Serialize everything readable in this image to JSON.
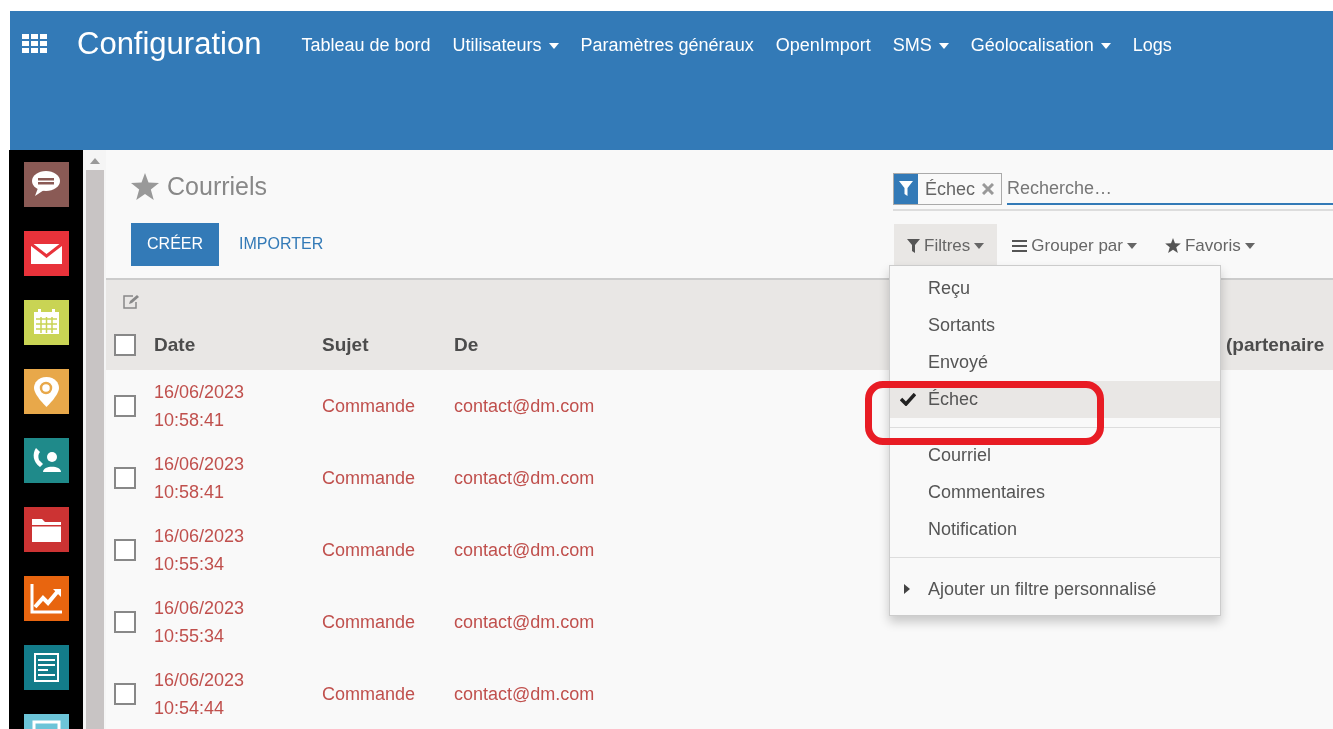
{
  "navbar": {
    "app_title": "Configuration",
    "menu": [
      {
        "label": "Tableau de bord",
        "dropdown": false
      },
      {
        "label": "Utilisateurs",
        "dropdown": true
      },
      {
        "label": "Paramètres généraux",
        "dropdown": false
      },
      {
        "label": "OpenImport",
        "dropdown": false
      },
      {
        "label": "SMS",
        "dropdown": true
      },
      {
        "label": "Géolocalisation",
        "dropdown": true
      },
      {
        "label": "Logs",
        "dropdown": false
      }
    ]
  },
  "sidebar": {
    "apps": [
      {
        "kind": "chat",
        "color": "#8a5a55"
      },
      {
        "kind": "mail",
        "color": "#e8323a"
      },
      {
        "kind": "calendar",
        "color": "#c9d454"
      },
      {
        "kind": "pin",
        "color": "#e8a84a"
      },
      {
        "kind": "phone",
        "color": "#1f8a8a"
      },
      {
        "kind": "folder",
        "color": "#cc3333"
      },
      {
        "kind": "chart",
        "color": "#e8650f"
      },
      {
        "kind": "document",
        "color": "#137c8a"
      },
      {
        "kind": "window",
        "color": "#6cc4d8"
      }
    ]
  },
  "breadcrumb": {
    "title": "Courriels"
  },
  "buttons": [
    {
      "label": "CRÉER",
      "kind": "primary"
    },
    {
      "label": "IMPORTER",
      "kind": "link"
    }
  ],
  "search": {
    "facet": "Échec",
    "placeholder": "Recherche…"
  },
  "search_options": [
    {
      "label": "Filtres",
      "kind": "filter",
      "selected": true
    },
    {
      "label": "Grouper par",
      "kind": "group",
      "selected": false
    },
    {
      "label": "Favoris",
      "kind": "star",
      "selected": false
    }
  ],
  "filter_menu": {
    "groups": [
      [
        {
          "label": "Reçu",
          "checked": false
        },
        {
          "label": "Sortants",
          "checked": false
        },
        {
          "label": "Envoyé",
          "checked": false
        },
        {
          "label": "Échec",
          "checked": true
        }
      ],
      [
        {
          "label": "Courriel",
          "checked": false
        },
        {
          "label": "Commentaires",
          "checked": false
        },
        {
          "label": "Notification",
          "checked": false
        }
      ]
    ],
    "custom_filter": "Ajouter un filtre personnalisé"
  },
  "table": {
    "all_selected": false,
    "columns": [
      "Date",
      "Sujet",
      "De",
      "(partenaire"
    ],
    "rows": [
      {
        "date": "16/06/2023",
        "time": "10:58:41",
        "subject": "Commande",
        "from": "contact@dm.com",
        "selected": false
      },
      {
        "date": "16/06/2023",
        "time": "10:58:41",
        "subject": "Commande",
        "from": "contact@dm.com",
        "selected": false
      },
      {
        "date": "16/06/2023",
        "time": "10:55:34",
        "subject": "Commande",
        "from": "contact@dm.com",
        "selected": false
      },
      {
        "date": "16/06/2023",
        "time": "10:55:34",
        "subject": "Commande",
        "from": "contact@dm.com",
        "selected": false
      },
      {
        "date": "16/06/2023",
        "time": "10:54:44",
        "subject": "Commande",
        "from": "contact@dm.com",
        "selected": false
      }
    ]
  }
}
